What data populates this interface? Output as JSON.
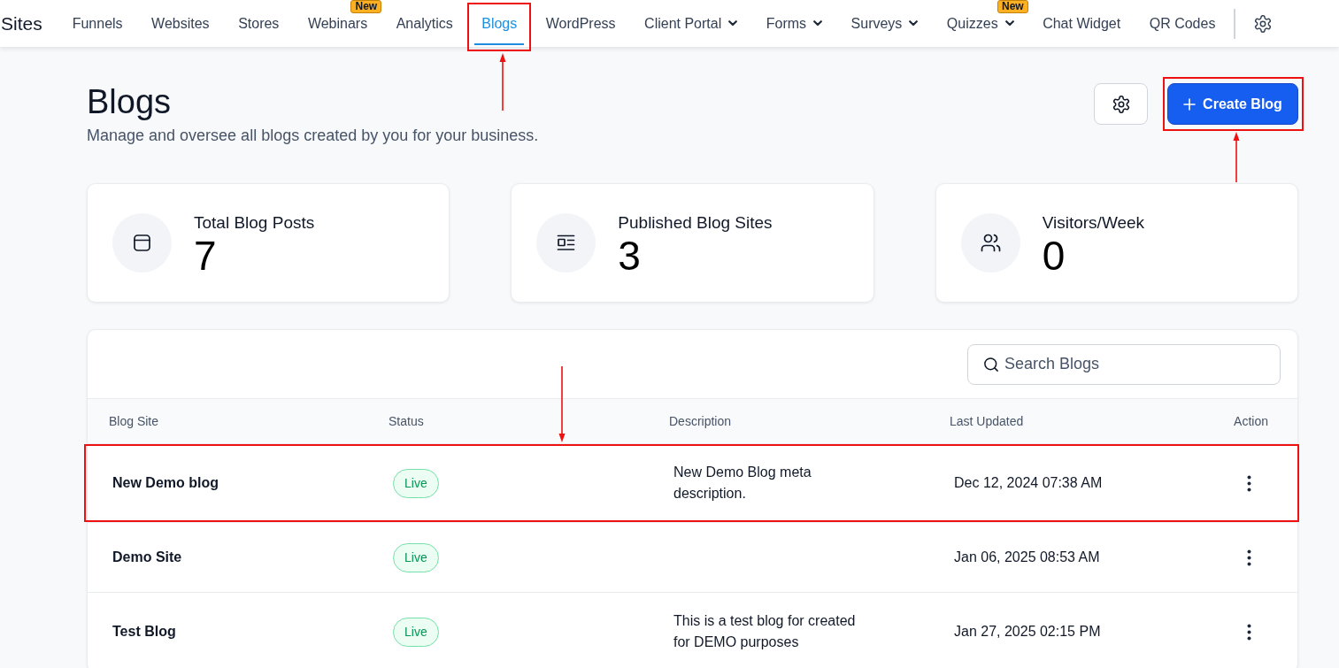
{
  "app_title": "Sites",
  "nav": [
    {
      "label": "Funnels",
      "selected": false,
      "dropdown": false,
      "highlighted": false
    },
    {
      "label": "Websites",
      "selected": false,
      "dropdown": false,
      "highlighted": false
    },
    {
      "label": "Stores",
      "selected": false,
      "dropdown": false,
      "highlighted": false
    },
    {
      "label": "Webinars",
      "selected": false,
      "dropdown": false,
      "highlighted": false,
      "badge": "New"
    },
    {
      "label": "Analytics",
      "selected": false,
      "dropdown": false,
      "highlighted": false
    },
    {
      "label": "Blogs",
      "selected": true,
      "dropdown": false,
      "highlighted": true
    },
    {
      "label": "WordPress",
      "selected": false,
      "dropdown": false,
      "highlighted": false
    },
    {
      "label": "Client Portal",
      "selected": false,
      "dropdown": true,
      "highlighted": false
    },
    {
      "label": "Forms",
      "selected": false,
      "dropdown": true,
      "highlighted": false
    },
    {
      "label": "Surveys",
      "selected": false,
      "dropdown": true,
      "highlighted": false
    },
    {
      "label": "Quizzes",
      "selected": false,
      "dropdown": true,
      "highlighted": false,
      "badge": "New"
    },
    {
      "label": "Chat Widget",
      "selected": false,
      "dropdown": false,
      "highlighted": false
    },
    {
      "label": "QR Codes",
      "selected": false,
      "dropdown": false,
      "highlighted": false
    }
  ],
  "page": {
    "title": "Blogs",
    "subtitle": "Manage and oversee all blogs created by you for your business.",
    "create_button": {
      "label": "Create Blog",
      "highlighted": true
    }
  },
  "stats": [
    {
      "label": "Total Blog Posts",
      "value": "7"
    },
    {
      "label": "Published Blog Sites",
      "value": "3"
    },
    {
      "label": "Visitors/Week",
      "value": "0"
    }
  ],
  "table": {
    "search": {
      "placeholder": "Search Blogs"
    },
    "columns": [
      "Blog Site",
      "Status",
      "Description",
      "Last Updated",
      "Action"
    ],
    "rows": [
      {
        "name": "New Demo blog",
        "status": "Live",
        "description": "New Demo Blog meta description.",
        "last_updated": "Dec 12, 2024 07:38 AM",
        "highlighted": true
      },
      {
        "name": "Demo Site",
        "status": "Live",
        "last_updated": "Jan 06, 2025 08:53 AM",
        "highlighted": false
      },
      {
        "name": "Test Blog",
        "status": "Live",
        "description": "This is a test blog for created for DEMO purposes",
        "last_updated": "Jan 27, 2025 02:15 PM",
        "highlighted": false
      }
    ]
  }
}
